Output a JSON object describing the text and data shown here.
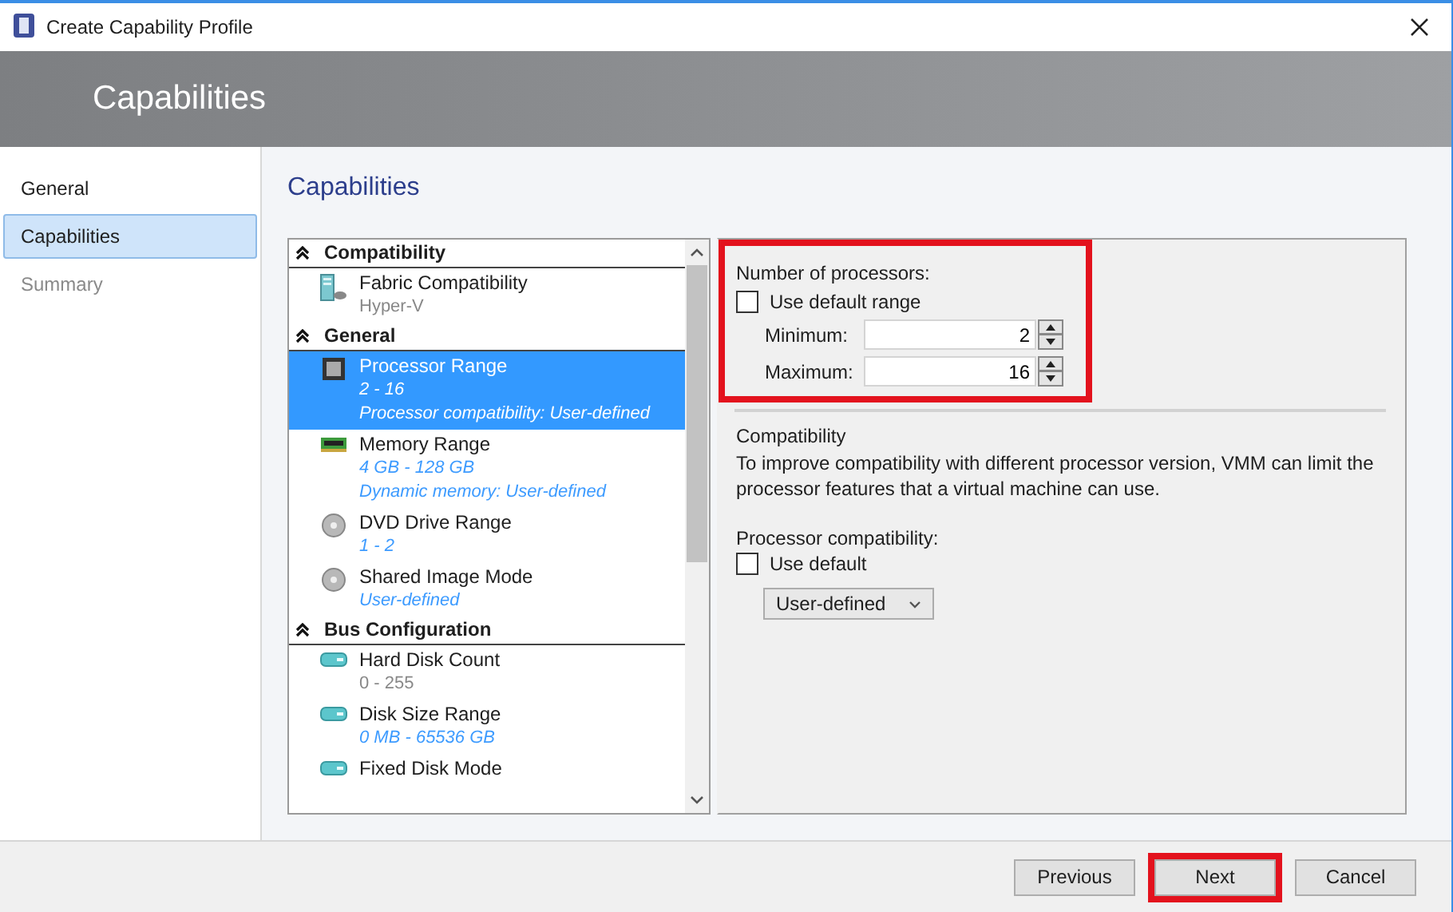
{
  "window": {
    "title": "Create Capability Profile"
  },
  "header": {
    "title": "Capabilities"
  },
  "nav": [
    {
      "label": "General",
      "selected": false,
      "disabled": false
    },
    {
      "label": "Capabilities",
      "selected": true,
      "disabled": false
    },
    {
      "label": "Summary",
      "selected": false,
      "disabled": true
    }
  ],
  "content": {
    "title": "Capabilities"
  },
  "capability_list": [
    {
      "title": "Compatibility",
      "expanded": true,
      "items": [
        {
          "name": "Fabric Compatibility",
          "kind": "server",
          "selected": false,
          "details": [
            {
              "text": "Hyper-V",
              "kind": "plain"
            }
          ]
        }
      ]
    },
    {
      "title": "General",
      "expanded": true,
      "items": [
        {
          "name": "Processor Range",
          "kind": "chip",
          "selected": true,
          "details": [
            {
              "text": "2 - 16",
              "kind": "custom"
            },
            {
              "text": "Processor compatibility: User-defined",
              "kind": "custom"
            }
          ]
        },
        {
          "name": "Memory Range",
          "kind": "memory",
          "selected": false,
          "details": [
            {
              "text": "4  GB - 128  GB",
              "kind": "custom"
            },
            {
              "text": "Dynamic memory: User-defined",
              "kind": "custom"
            }
          ]
        },
        {
          "name": "DVD Drive Range",
          "kind": "disc",
          "selected": false,
          "details": [
            {
              "text": "1 - 2",
              "kind": "custom"
            }
          ]
        },
        {
          "name": "Shared Image Mode",
          "kind": "disc",
          "selected": false,
          "details": [
            {
              "text": "User-defined",
              "kind": "custom"
            }
          ]
        }
      ]
    },
    {
      "title": "Bus Configuration",
      "expanded": true,
      "items": [
        {
          "name": "Hard Disk Count",
          "kind": "disk",
          "selected": false,
          "details": [
            {
              "text": "0 - 255",
              "kind": "plain"
            }
          ]
        },
        {
          "name": "Disk Size Range",
          "kind": "disk",
          "selected": false,
          "details": [
            {
              "text": "0 MB - 65536  GB",
              "kind": "custom"
            }
          ]
        },
        {
          "name": "Fixed Disk Mode",
          "kind": "disk",
          "selected": false
        }
      ]
    }
  ],
  "processors": {
    "label": "Number of processors:",
    "highlighted": true,
    "use_default": {
      "label": "Use default range",
      "checked": false
    },
    "minimum": {
      "label": "Minimum:",
      "value": "2"
    },
    "maximum": {
      "label": "Maximum:",
      "value": "16"
    }
  },
  "compatibility": {
    "heading": "Compatibility",
    "description": "To improve compatibility with different processor version, VMM can limit the processor features that a virtual machine can use.",
    "field_label": "Processor compatibility:",
    "use_default": {
      "label": "Use default",
      "checked": false
    },
    "dropdown": {
      "value": "User-defined"
    }
  },
  "buttons": [
    {
      "label": "Previous",
      "highlighted": false
    },
    {
      "label": "Next",
      "highlighted": true
    },
    {
      "label": "Cancel",
      "highlighted": false
    }
  ]
}
